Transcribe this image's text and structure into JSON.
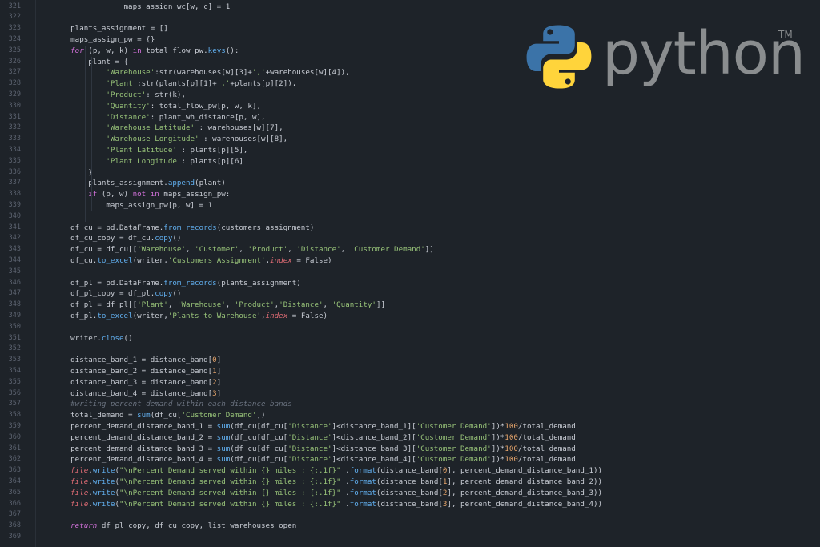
{
  "brand": {
    "wordmark": "python",
    "trademark": "TM",
    "logo_icon": "python-logo-icon",
    "colors": {
      "blue": "#3b73a8",
      "yellow": "#ffd43b",
      "wordmark": "#8a8d8f"
    }
  },
  "editor": {
    "theme": {
      "background": "#1e2329",
      "line_number": "#5c6370"
    },
    "lines": [
      {
        "num": "321",
        "tokens": [
          {
            "t": "                maps_assign_wc[w, c] = 1"
          }
        ]
      },
      {
        "num": "322",
        "tokens": []
      },
      {
        "num": "323",
        "tokens": [
          {
            "t": "    plants_assignment = []"
          }
        ]
      },
      {
        "num": "324",
        "tokens": [
          {
            "t": "    maps_assign_pw = {}"
          }
        ]
      },
      {
        "num": "325",
        "tokens": [
          {
            "t": "    "
          },
          {
            "t": "for",
            "c": "kwi"
          },
          {
            "t": " (p, w, k) "
          },
          {
            "t": "in",
            "c": "kw"
          },
          {
            "t": " total_flow_pw."
          },
          {
            "t": "keys",
            "c": "fn"
          },
          {
            "t": "():"
          }
        ]
      },
      {
        "num": "326",
        "tokens": [
          {
            "t": "        plant = {"
          }
        ]
      },
      {
        "num": "327",
        "tokens": [
          {
            "t": "            "
          },
          {
            "t": "'Warehouse'",
            "c": "st"
          },
          {
            "t": ":str(warehouses[w][3]+"
          },
          {
            "t": "','",
            "c": "st"
          },
          {
            "t": "+warehouses[w][4]),"
          }
        ]
      },
      {
        "num": "328",
        "tokens": [
          {
            "t": "            "
          },
          {
            "t": "'Plant'",
            "c": "st"
          },
          {
            "t": ":str(plants[p][1]+"
          },
          {
            "t": "','",
            "c": "st"
          },
          {
            "t": "+plants[p][2]),"
          }
        ]
      },
      {
        "num": "329",
        "tokens": [
          {
            "t": "            "
          },
          {
            "t": "'Product'",
            "c": "st"
          },
          {
            "t": ": str(k),"
          }
        ]
      },
      {
        "num": "330",
        "tokens": [
          {
            "t": "            "
          },
          {
            "t": "'Quantity'",
            "c": "st"
          },
          {
            "t": ": total_flow_pw[p, w, k],"
          }
        ]
      },
      {
        "num": "331",
        "tokens": [
          {
            "t": "            "
          },
          {
            "t": "'Distance'",
            "c": "st"
          },
          {
            "t": ": plant_wh_distance[p, w],"
          }
        ]
      },
      {
        "num": "332",
        "tokens": [
          {
            "t": "            "
          },
          {
            "t": "'Warehouse Latitude'",
            "c": "st"
          },
          {
            "t": " : warehouses[w][7],"
          }
        ]
      },
      {
        "num": "333",
        "tokens": [
          {
            "t": "            "
          },
          {
            "t": "'Warehouse Longitude'",
            "c": "st"
          },
          {
            "t": " : warehouses[w][8],"
          }
        ]
      },
      {
        "num": "334",
        "tokens": [
          {
            "t": "            "
          },
          {
            "t": "'Plant Latitude'",
            "c": "st"
          },
          {
            "t": " : plants[p][5],"
          }
        ]
      },
      {
        "num": "335",
        "tokens": [
          {
            "t": "            "
          },
          {
            "t": "'Plant Longitude'",
            "c": "st"
          },
          {
            "t": ": plants[p][6]"
          }
        ]
      },
      {
        "num": "336",
        "tokens": [
          {
            "t": "        }"
          }
        ]
      },
      {
        "num": "337",
        "tokens": [
          {
            "t": "        plants_assignment."
          },
          {
            "t": "append",
            "c": "fn"
          },
          {
            "t": "(plant)"
          }
        ]
      },
      {
        "num": "338",
        "tokens": [
          {
            "t": "        "
          },
          {
            "t": "if",
            "c": "kw"
          },
          {
            "t": " (p, w) "
          },
          {
            "t": "not in",
            "c": "kw"
          },
          {
            "t": " maps_assign_pw:"
          }
        ]
      },
      {
        "num": "339",
        "tokens": [
          {
            "t": "            maps_assign_pw[p, w] = 1"
          }
        ]
      },
      {
        "num": "340",
        "tokens": []
      },
      {
        "num": "341",
        "tokens": [
          {
            "t": "    df_cu = pd.DataFrame."
          },
          {
            "t": "from_records",
            "c": "fn"
          },
          {
            "t": "(customers_assignment)"
          }
        ]
      },
      {
        "num": "342",
        "tokens": [
          {
            "t": "    df_cu_copy = df_cu."
          },
          {
            "t": "copy",
            "c": "fn"
          },
          {
            "t": "()"
          }
        ]
      },
      {
        "num": "343",
        "tokens": [
          {
            "t": "    df_cu = df_cu[["
          },
          {
            "t": "'Warehouse'",
            "c": "st"
          },
          {
            "t": ", "
          },
          {
            "t": "'Customer'",
            "c": "st"
          },
          {
            "t": ", "
          },
          {
            "t": "'Product'",
            "c": "st"
          },
          {
            "t": ", "
          },
          {
            "t": "'Distance'",
            "c": "st"
          },
          {
            "t": ", "
          },
          {
            "t": "'Customer Demand'",
            "c": "st"
          },
          {
            "t": "]]"
          }
        ]
      },
      {
        "num": "344",
        "tokens": [
          {
            "t": "    df_cu."
          },
          {
            "t": "to_excel",
            "c": "fn"
          },
          {
            "t": "(writer,"
          },
          {
            "t": "'Customers Assignment'",
            "c": "st"
          },
          {
            "t": ","
          },
          {
            "t": "index",
            "c": "pm"
          },
          {
            "t": " = False)"
          }
        ]
      },
      {
        "num": "345",
        "tokens": []
      },
      {
        "num": "346",
        "tokens": [
          {
            "t": "    df_pl = pd.DataFrame."
          },
          {
            "t": "from_records",
            "c": "fn"
          },
          {
            "t": "(plants_assignment)"
          }
        ]
      },
      {
        "num": "347",
        "tokens": [
          {
            "t": "    df_pl_copy = df_pl."
          },
          {
            "t": "copy",
            "c": "fn"
          },
          {
            "t": "()"
          }
        ]
      },
      {
        "num": "348",
        "tokens": [
          {
            "t": "    df_pl = df_pl[["
          },
          {
            "t": "'Plant'",
            "c": "st"
          },
          {
            "t": ", "
          },
          {
            "t": "'Warehouse'",
            "c": "st"
          },
          {
            "t": ", "
          },
          {
            "t": "'Product'",
            "c": "st"
          },
          {
            "t": ","
          },
          {
            "t": "'Distance'",
            "c": "st"
          },
          {
            "t": ", "
          },
          {
            "t": "'Quantity'",
            "c": "st"
          },
          {
            "t": "]]"
          }
        ]
      },
      {
        "num": "349",
        "tokens": [
          {
            "t": "    df_pl."
          },
          {
            "t": "to_excel",
            "c": "fn"
          },
          {
            "t": "(writer,"
          },
          {
            "t": "'Plants to Warehouse'",
            "c": "st"
          },
          {
            "t": ","
          },
          {
            "t": "index",
            "c": "pm"
          },
          {
            "t": " = False)"
          }
        ]
      },
      {
        "num": "350",
        "tokens": []
      },
      {
        "num": "351",
        "tokens": [
          {
            "t": "    writer."
          },
          {
            "t": "close",
            "c": "fn"
          },
          {
            "t": "()"
          }
        ]
      },
      {
        "num": "352",
        "tokens": []
      },
      {
        "num": "353",
        "tokens": [
          {
            "t": "    distance_band_1 = distance_band["
          },
          {
            "t": "0",
            "c": "nm"
          },
          {
            "t": "]"
          }
        ]
      },
      {
        "num": "354",
        "tokens": [
          {
            "t": "    distance_band_2 = distance_band["
          },
          {
            "t": "1",
            "c": "nm"
          },
          {
            "t": "]"
          }
        ]
      },
      {
        "num": "355",
        "tokens": [
          {
            "t": "    distance_band_3 = distance_band["
          },
          {
            "t": "2",
            "c": "nm"
          },
          {
            "t": "]"
          }
        ]
      },
      {
        "num": "356",
        "tokens": [
          {
            "t": "    distance_band_4 = distance_band["
          },
          {
            "t": "3",
            "c": "nm"
          },
          {
            "t": "]"
          }
        ]
      },
      {
        "num": "357",
        "tokens": [
          {
            "t": "    "
          },
          {
            "t": "#writing percent demand within each distance bands",
            "c": "cm"
          }
        ]
      },
      {
        "num": "358",
        "tokens": [
          {
            "t": "    total_demand = "
          },
          {
            "t": "sum",
            "c": "fn"
          },
          {
            "t": "(df_cu["
          },
          {
            "t": "'Customer Demand'",
            "c": "st"
          },
          {
            "t": "])"
          }
        ]
      },
      {
        "num": "359",
        "tokens": [
          {
            "t": "    percent_demand_distance_band_1 = "
          },
          {
            "t": "sum",
            "c": "fn"
          },
          {
            "t": "(df_cu[df_cu["
          },
          {
            "t": "'Distance'",
            "c": "st"
          },
          {
            "t": "]<distance_band_1]["
          },
          {
            "t": "'Customer Demand'",
            "c": "st"
          },
          {
            "t": "])*"
          },
          {
            "t": "100",
            "c": "nm"
          },
          {
            "t": "/total_demand"
          }
        ]
      },
      {
        "num": "360",
        "tokens": [
          {
            "t": "    percent_demand_distance_band_2 = "
          },
          {
            "t": "sum",
            "c": "fn"
          },
          {
            "t": "(df_cu[df_cu["
          },
          {
            "t": "'Distance'",
            "c": "st"
          },
          {
            "t": "]<distance_band_2]["
          },
          {
            "t": "'Customer Demand'",
            "c": "st"
          },
          {
            "t": "])*"
          },
          {
            "t": "100",
            "c": "nm"
          },
          {
            "t": "/total_demand"
          }
        ]
      },
      {
        "num": "361",
        "tokens": [
          {
            "t": "    percent_demand_distance_band_3 = "
          },
          {
            "t": "sum",
            "c": "fn"
          },
          {
            "t": "(df_cu[df_cu["
          },
          {
            "t": "'Distance'",
            "c": "st"
          },
          {
            "t": "]<distance_band_3]["
          },
          {
            "t": "'Customer Demand'",
            "c": "st"
          },
          {
            "t": "])*"
          },
          {
            "t": "100",
            "c": "nm"
          },
          {
            "t": "/total_demand"
          }
        ]
      },
      {
        "num": "362",
        "tokens": [
          {
            "t": "    percent_demand_distance_band_4 = "
          },
          {
            "t": "sum",
            "c": "fn"
          },
          {
            "t": "(df_cu[df_cu["
          },
          {
            "t": "'Distance'",
            "c": "st"
          },
          {
            "t": "]<distance_band_4]["
          },
          {
            "t": "'Customer Demand'",
            "c": "st"
          },
          {
            "t": "])*"
          },
          {
            "t": "100",
            "c": "nm"
          },
          {
            "t": "/total_demand"
          }
        ]
      },
      {
        "num": "363",
        "tokens": [
          {
            "t": "    "
          },
          {
            "t": "file",
            "c": "pm"
          },
          {
            "t": "."
          },
          {
            "t": "write",
            "c": "fn"
          },
          {
            "t": "("
          },
          {
            "t": "\"\\nPercent Demand served within {} miles : {:.1f}\"",
            "c": "st"
          },
          {
            "t": " ."
          },
          {
            "t": "format",
            "c": "fn"
          },
          {
            "t": "(distance_band["
          },
          {
            "t": "0",
            "c": "nm"
          },
          {
            "t": "], percent_demand_distance_band_1))"
          }
        ]
      },
      {
        "num": "364",
        "tokens": [
          {
            "t": "    "
          },
          {
            "t": "file",
            "c": "pm"
          },
          {
            "t": "."
          },
          {
            "t": "write",
            "c": "fn"
          },
          {
            "t": "("
          },
          {
            "t": "\"\\nPercent Demand served within {} miles : {:.1f}\"",
            "c": "st"
          },
          {
            "t": " ."
          },
          {
            "t": "format",
            "c": "fn"
          },
          {
            "t": "(distance_band["
          },
          {
            "t": "1",
            "c": "nm"
          },
          {
            "t": "], percent_demand_distance_band_2))"
          }
        ]
      },
      {
        "num": "365",
        "tokens": [
          {
            "t": "    "
          },
          {
            "t": "file",
            "c": "pm"
          },
          {
            "t": "."
          },
          {
            "t": "write",
            "c": "fn"
          },
          {
            "t": "("
          },
          {
            "t": "\"\\nPercent Demand served within {} miles : {:.1f}\"",
            "c": "st"
          },
          {
            "t": " ."
          },
          {
            "t": "format",
            "c": "fn"
          },
          {
            "t": "(distance_band["
          },
          {
            "t": "2",
            "c": "nm"
          },
          {
            "t": "], percent_demand_distance_band_3))"
          }
        ]
      },
      {
        "num": "366",
        "tokens": [
          {
            "t": "    "
          },
          {
            "t": "file",
            "c": "pm"
          },
          {
            "t": "."
          },
          {
            "t": "write",
            "c": "fn"
          },
          {
            "t": "("
          },
          {
            "t": "\"\\nPercent Demand served within {} miles : {:.1f}\"",
            "c": "st"
          },
          {
            "t": " ."
          },
          {
            "t": "format",
            "c": "fn"
          },
          {
            "t": "(distance_band["
          },
          {
            "t": "3",
            "c": "nm"
          },
          {
            "t": "], percent_demand_distance_band_4))"
          }
        ]
      },
      {
        "num": "367",
        "tokens": []
      },
      {
        "num": "368",
        "tokens": [
          {
            "t": "    "
          },
          {
            "t": "return",
            "c": "kwi"
          },
          {
            "t": " df_pl_copy, df_cu_copy, list_warehouses_open"
          }
        ]
      },
      {
        "num": "369",
        "tokens": []
      }
    ]
  }
}
